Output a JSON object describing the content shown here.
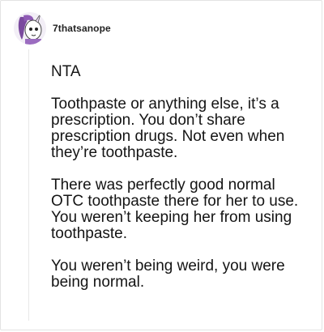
{
  "post": {
    "username": "7thatsanope",
    "avatar_icon": "cartoon-unicorn-avatar-icon",
    "paragraphs": [
      "NTA",
      "Toothpaste or anything else, it’s a prescription. You don’t share prescription drugs. Not even when they’re toothpaste.",
      "There was perfectly good normal OTC toothpaste there for her to use. You weren’t keeping her from using toothpaste.",
      "You weren’t being weird, you were being normal."
    ]
  },
  "colors": {
    "avatar_purple": "#7a4a9e",
    "avatar_light": "#f2eef6",
    "text": "#141414",
    "border": "#e3e3e3"
  }
}
